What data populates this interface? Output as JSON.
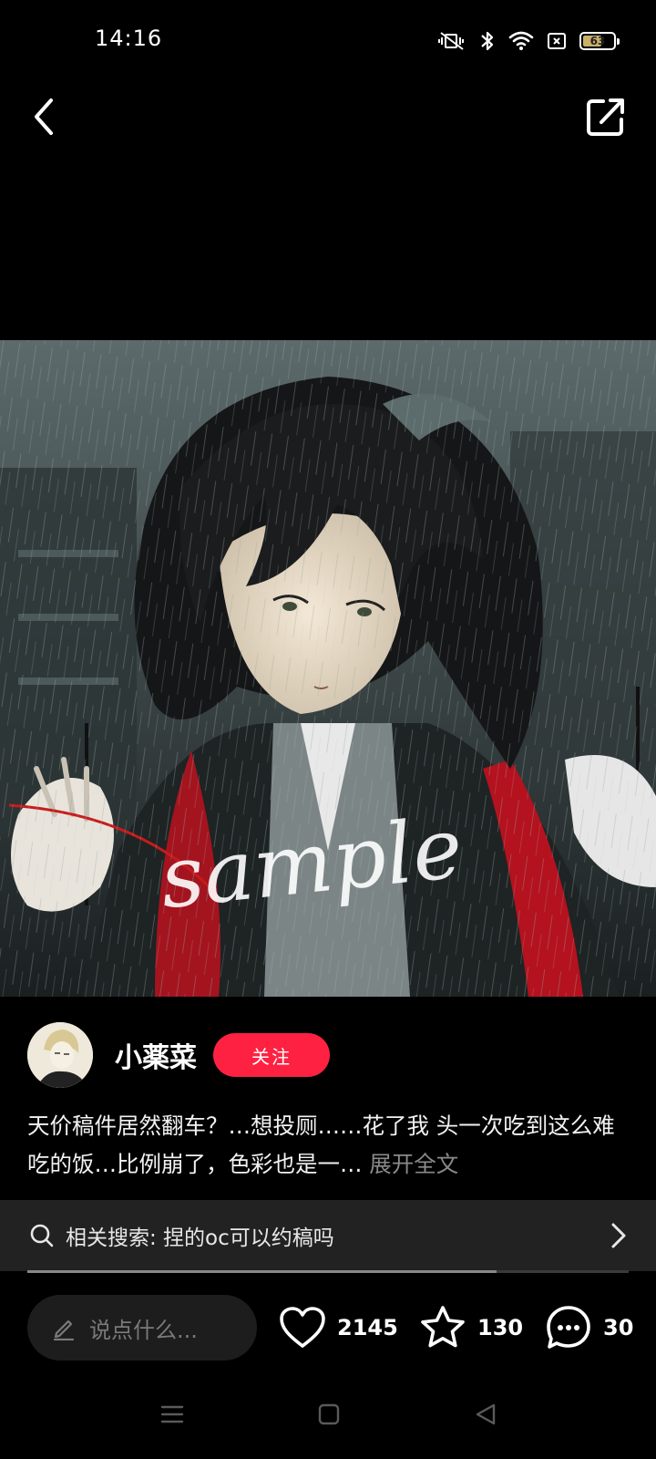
{
  "status_bar": {
    "time": "14:16",
    "battery_level": 63,
    "battery_label": "63",
    "icons": [
      "mute-vibrate-icon",
      "bluetooth-icon",
      "wifi-icon",
      "sim-off-icon",
      "battery-icon"
    ]
  },
  "nav": {
    "back_icon": "chevron-left-icon",
    "share_icon": "share-external-icon"
  },
  "artwork": {
    "watermark": "sample"
  },
  "author": {
    "name": "小薬菜",
    "follow_label": "关注"
  },
  "caption": {
    "text": "天价稿件居然翻车？…想投厕……花了我 头一次吃到这么难吃的饭…比例崩了，色彩也是一…",
    "expand_label": "展开全文"
  },
  "related_search": {
    "text": "相关搜索: 捏的oc可以约稿吗"
  },
  "gallery_progress": 0.78,
  "actions": {
    "comment_placeholder": "说点什么...",
    "likes": "2145",
    "favorites": "130",
    "comments": "30"
  },
  "colors": {
    "accent": "#ff2142",
    "background": "#000000",
    "search_bar": "#222222"
  }
}
